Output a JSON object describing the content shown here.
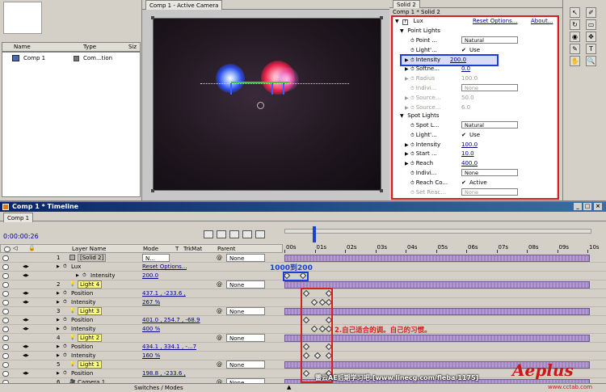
{
  "project_panel": {
    "col_name": "Name",
    "col_type": "Type",
    "col_size": "Siz",
    "item_name": "Comp 1",
    "item_type": "Com...tion"
  },
  "comp_viewer": {
    "tab_label": "Comp 1 - Active Camera"
  },
  "effect_panel": {
    "tab_label": "Solid 2",
    "crumb": "Comp 1 * Solid 2",
    "effect_name": "Lux",
    "reset_label": "Reset Options...",
    "about_label": "About...",
    "point_lights_label": "Point Lights",
    "point_lights": [
      {
        "label": "Point ...",
        "value": "Natural",
        "kind": "dropdown"
      },
      {
        "label": "Light'...",
        "value": "Use",
        "kind": "check"
      },
      {
        "label": "Intensity",
        "value": "200.0",
        "kind": "value",
        "highlight": true
      },
      {
        "label": "Softne...",
        "value": "0.0",
        "kind": "value"
      },
      {
        "label": "Radius",
        "value": "100.0",
        "kind": "value",
        "disabled": true
      },
      {
        "label": "Indivi...",
        "value": "None",
        "kind": "dropdown",
        "disabled": true
      },
      {
        "label": "Source...",
        "value": "50.0",
        "kind": "value",
        "disabled": true
      },
      {
        "label": "Source...",
        "value": "6.0",
        "kind": "value",
        "disabled": true
      }
    ],
    "spot_lights_label": "Spot Lights",
    "spot_lights": [
      {
        "label": "Spot L...",
        "value": "Natural",
        "kind": "dropdown"
      },
      {
        "label": "Light'...",
        "value": "Use",
        "kind": "check"
      },
      {
        "label": "Intensity",
        "value": "100.0",
        "kind": "value"
      },
      {
        "label": "Start ...",
        "value": "10.0",
        "kind": "value"
      },
      {
        "label": "Reach",
        "value": "400.0",
        "kind": "value"
      },
      {
        "label": "Indivi...",
        "value": "None",
        "kind": "dropdown"
      },
      {
        "label": "Reach Co...",
        "value": "Active",
        "kind": "check"
      },
      {
        "label": "Set Reac...",
        "value": "None",
        "kind": "dropdown",
        "disabled": true
      }
    ]
  },
  "timeline": {
    "title": "Comp 1 * Timeline",
    "tab_label": "Comp 1",
    "timecode": "0:00:00:26",
    "ruler": [
      "00s",
      "01s",
      "02s",
      "03s",
      "04s",
      "05s",
      "06s",
      "07s",
      "08s",
      "09s",
      "10s"
    ],
    "header": {
      "layer_name": "Layer Name",
      "mode": "Mode",
      "t": "T",
      "trkmat": "TrkMat",
      "parent": "Parent"
    },
    "annotation_1": "1000到200",
    "annotation_2": "2.自己适合的调。自己的习惯。",
    "footer_label": "Switches / Modes",
    "watermark": "雷云AE后期学习吧-[www.linecg.com/fleba/1175]",
    "logo_text": "Aeplus",
    "logo_url": "www.cctab.com",
    "rows": [
      {
        "kind": "layer",
        "num": "1",
        "name": "[Solid 2]",
        "mode": "N...",
        "parent": "None"
      },
      {
        "kind": "prop",
        "indent": 1,
        "name": "Lux",
        "value": "Reset Options...",
        "link": true
      },
      {
        "kind": "prop",
        "indent": 2,
        "name": "Intensity",
        "value": "200.0",
        "val_link": true
      },
      {
        "kind": "layer",
        "num": "2",
        "name": "Light 4",
        "light": true,
        "parent": "None"
      },
      {
        "kind": "prop",
        "indent": 1,
        "name": "Position",
        "value": "437.1 , -233.6 ,"
      },
      {
        "kind": "prop",
        "indent": 1,
        "name": "Intensity",
        "value": "267 %"
      },
      {
        "kind": "layer",
        "num": "3",
        "name": "Light 3",
        "light": true,
        "parent": "None"
      },
      {
        "kind": "prop",
        "indent": 1,
        "name": "Position",
        "value": "401.0 , 254.7 , -68.9"
      },
      {
        "kind": "prop",
        "indent": 1,
        "name": "Intensity",
        "value": "400 %"
      },
      {
        "kind": "layer",
        "num": "4",
        "name": "Light 2",
        "light": true,
        "parent": "None"
      },
      {
        "kind": "prop",
        "indent": 1,
        "name": "Position",
        "value": "434.1 , 334.1 , -...7"
      },
      {
        "kind": "prop",
        "indent": 1,
        "name": "Intensity",
        "value": "160 %"
      },
      {
        "kind": "layer",
        "num": "5",
        "name": "Light 1",
        "light": true,
        "parent": "None"
      },
      {
        "kind": "prop",
        "indent": 1,
        "name": "Position",
        "value": "198.8 , -233.6 ,"
      },
      {
        "kind": "layer",
        "num": "6",
        "name": "Camera 1",
        "camera": true,
        "parent": "None"
      }
    ]
  },
  "colors": {
    "annotation_red": "#d42020",
    "highlight_blue": "#1c3dd6",
    "layer_bar": "#b49ad0"
  }
}
